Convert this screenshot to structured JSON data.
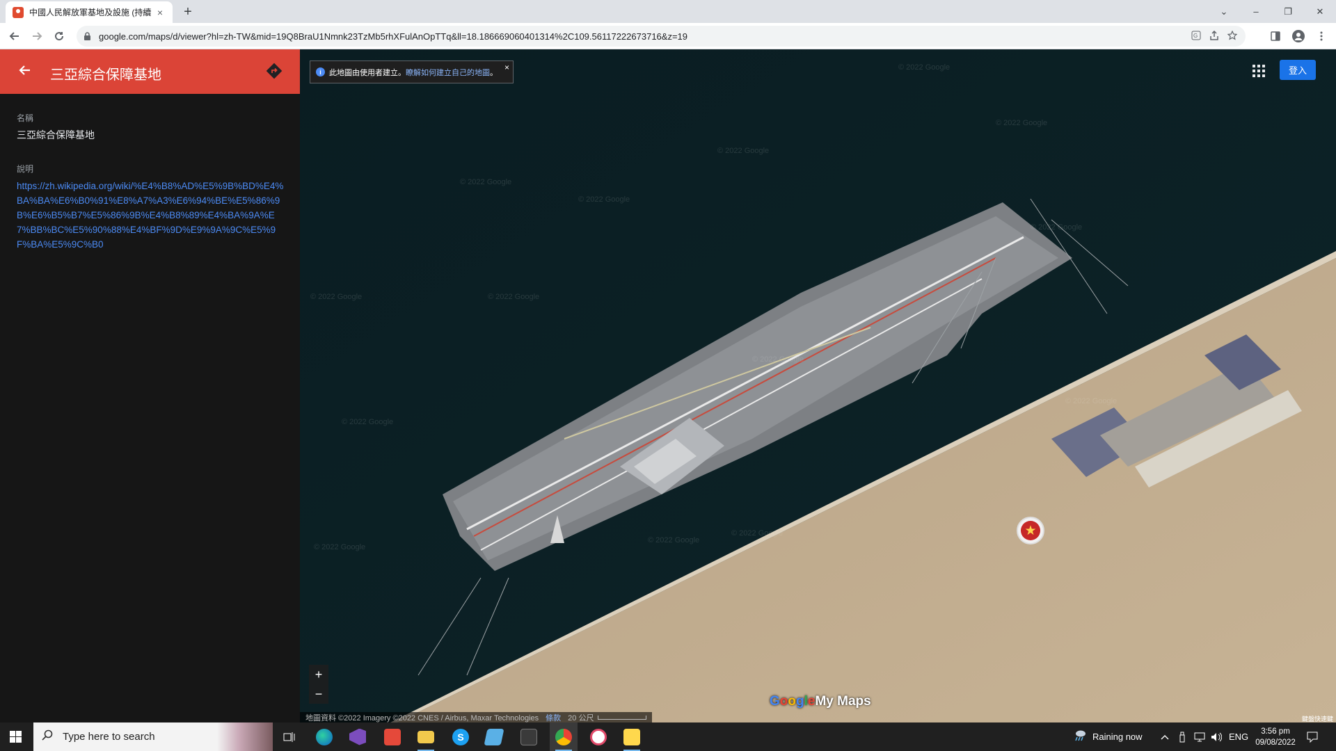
{
  "browser": {
    "tab_title": "中國人民解放軍基地及設施 (持續",
    "tab_close": "×",
    "new_tab": "+",
    "url": "google.com/maps/d/viewer?hl=zh-TW&mid=19Q8BraU1Nmnk23TzMb5rhXFulAnOpTTq&ll=18.186669060401314%2C109.56117222673716&z=19",
    "window_controls": {
      "chevron": "⌄",
      "minimize": "–",
      "restore": "❐",
      "close": "✕"
    }
  },
  "panel": {
    "title": "三亞綜合保障基地",
    "name_label": "名稱",
    "name_value": "三亞綜合保障基地",
    "desc_label": "說明",
    "desc_link": "https://zh.wikipedia.org/wiki/%E4%B8%AD%E5%9B%BD%E4%BA%BA%E6%B0%91%E8%A7%A3%E6%94%BE%E5%86%9B%E6%B5%B7%E5%86%9B%E4%B8%89%E4%BA%9A%E7%BB%BC%E5%90%88%E4%BF%9D%E9%9A%9C%E5%9F%BA%E5%9C%B0"
  },
  "map": {
    "banner_text": "此地圖由使用者建立。",
    "banner_link": "瞭解如何建立自己的地圖",
    "banner_suffix": "。",
    "banner_close": "×",
    "signin": "登入",
    "zoom_in": "+",
    "zoom_out": "−",
    "attribution": "地圖資料 ©2022 Imagery ©2022 CNES / Airbus, Maxar Technologies",
    "terms": "條款",
    "scale": "20 公尺",
    "logo_my_maps": "My Maps",
    "shortcut": "鍵盤快速鍵",
    "watermark": "© 2022 Google",
    "pin_glyph": "★"
  },
  "taskbar": {
    "search_placeholder": "Type here to search",
    "weather": "Raining now",
    "lang": "ENG",
    "time": "3:56 pm",
    "date": "09/08/2022"
  },
  "colors": {
    "panel_header": "#db4437",
    "link": "#4c8bf5",
    "signin": "#1a73e8"
  }
}
